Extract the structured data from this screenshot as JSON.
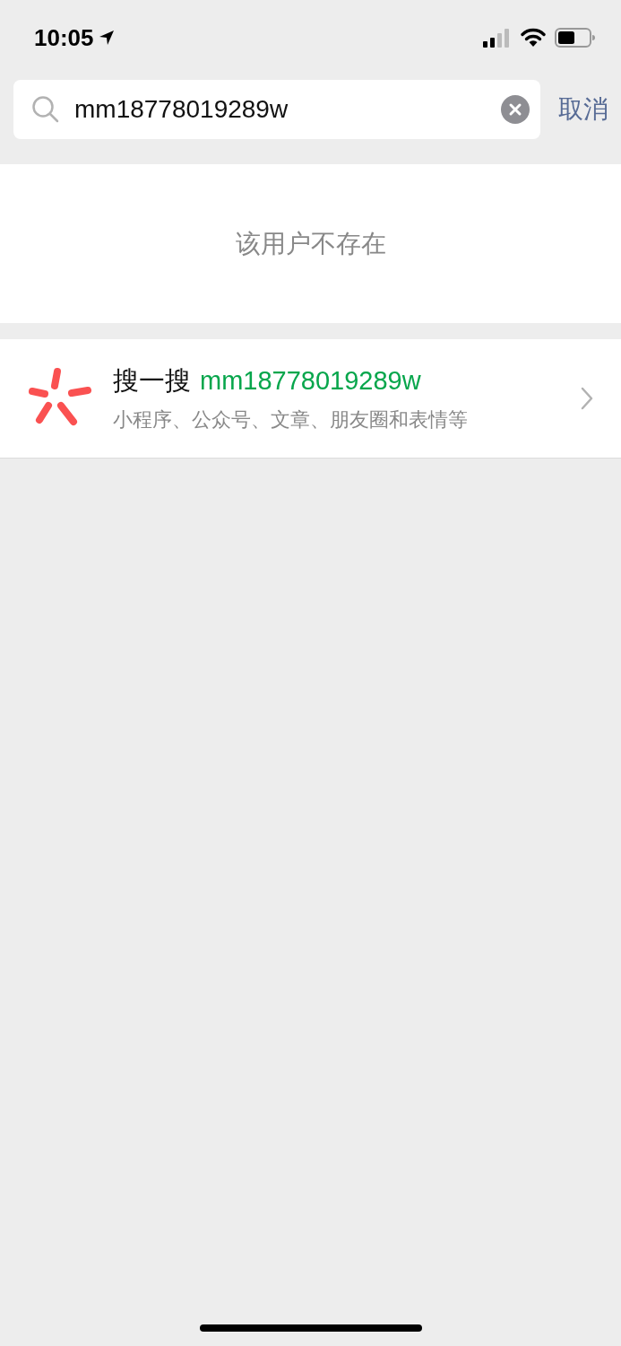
{
  "status_bar": {
    "time": "10:05"
  },
  "search": {
    "value": "mm18778019289w",
    "cancel": "取消"
  },
  "notice": "该用户不存在",
  "result": {
    "label": "搜一搜",
    "query": "mm18778019289w",
    "subtitle": "小程序、公众号、文章、朋友圈和表情等"
  }
}
